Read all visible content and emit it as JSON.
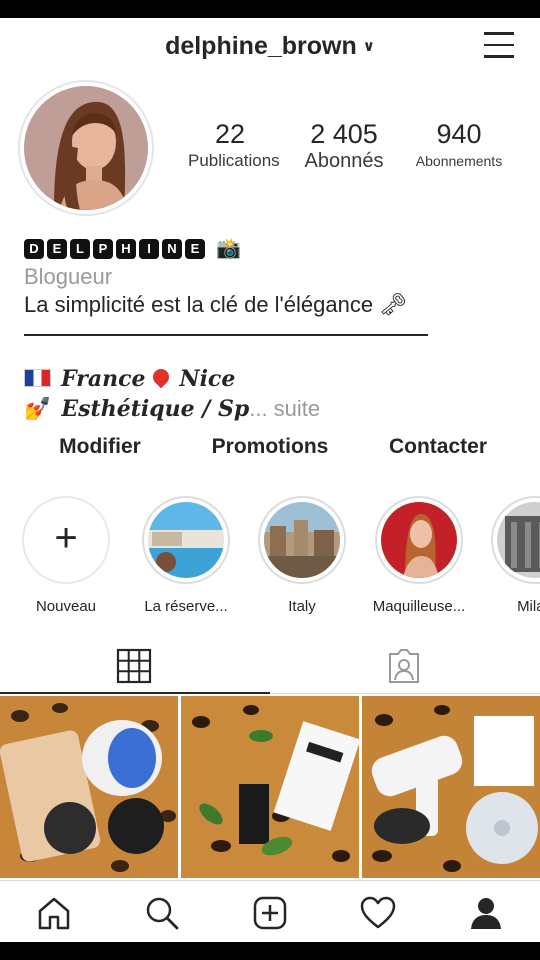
{
  "header": {
    "username": "delphine_brown",
    "chevron_icon": "chevron-down-icon",
    "menu_icon": "hamburger-menu-icon"
  },
  "profile": {
    "stats": [
      {
        "value": "22",
        "label": "Publications"
      },
      {
        "value": "2 405",
        "label": "Abonnés"
      },
      {
        "value": "940",
        "label": "Abonnements"
      }
    ],
    "display_name_letters": [
      "D",
      "E",
      "L",
      "P",
      "H",
      "I",
      "N",
      "E"
    ],
    "display_name_emoji": "📸",
    "category": "Blogueur",
    "tagline": "La simplicité est la clé de l'élégance 🗝",
    "bio_line1": "France",
    "bio_line1_b": "Nice",
    "bio_line2": "Esthétique / Sp",
    "bio_more": "... suite",
    "bio_line2_emoji": "💅"
  },
  "buttons": {
    "edit": "Modifier",
    "promotions": "Promotions",
    "contact": "Contacter"
  },
  "highlights": [
    {
      "label": "Nouveau"
    },
    {
      "label": "La réserve..."
    },
    {
      "label": "Italy"
    },
    {
      "label": "Maquilleuse..."
    },
    {
      "label": "Milan"
    }
  ],
  "tabs": {
    "grid_icon": "grid-icon",
    "tagged_icon": "tagged-person-icon",
    "active": "grid"
  },
  "nav": [
    "home-icon",
    "search-icon",
    "new-post-icon",
    "heart-icon",
    "profile-icon"
  ],
  "colors": {
    "text": "#262626",
    "muted": "#9a9a9a",
    "border": "#dbdbdb"
  }
}
